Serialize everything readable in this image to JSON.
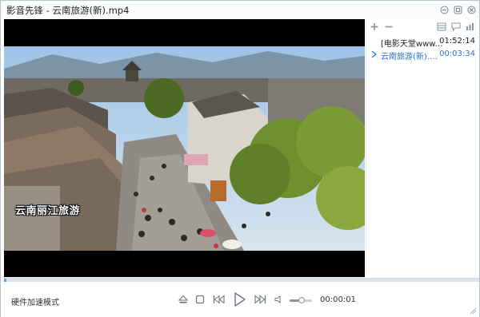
{
  "window": {
    "title": "影音先锋 - 云南旅游(新).mp4"
  },
  "title_buttons": [
    {
      "name": "minimize-button",
      "icon": "minimize-icon"
    },
    {
      "name": "restore-button",
      "icon": "restore-icon"
    },
    {
      "name": "close-button",
      "icon": "close-icon"
    }
  ],
  "video": {
    "overlay_text": "云南丽江旅游"
  },
  "playlist": {
    "toolbar_icons": [
      "add-icon",
      "remove-icon",
      "list-view-icon",
      "chat-icon",
      "bars-icon"
    ],
    "items": [
      {
        "name": "[电影天堂www.dyt...",
        "duration": "01:52:14",
        "active": false
      },
      {
        "name": "云南旅游(新).m...",
        "duration": "00:03:34",
        "active": true
      }
    ]
  },
  "playback": {
    "progress": 0.005,
    "volume": 0.55
  },
  "controls": {
    "hardware_label": "硬件加速模式",
    "current_time": "00:00:01",
    "buttons": [
      "eject-icon",
      "stop-icon",
      "previous-icon",
      "play-icon",
      "next-icon",
      "volume-icon"
    ]
  },
  "colors": {
    "accent": "#2b6fd8",
    "video_bg": "#000000",
    "seek_fill": "#6aa2e8"
  }
}
